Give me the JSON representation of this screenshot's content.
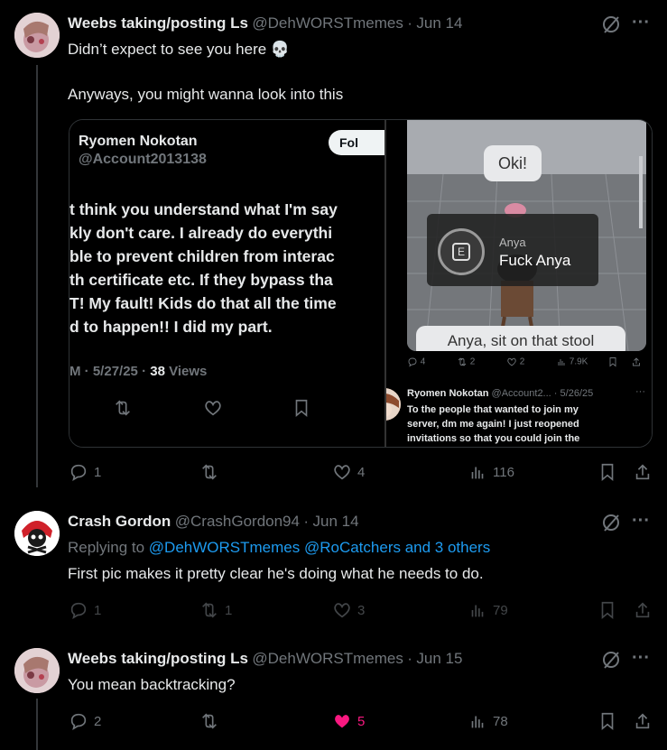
{
  "posts": [
    {
      "name": "Weebs taking/posting Ls",
      "handle": "@DehWORSTmemes",
      "sep": "·",
      "date": "Jun 14",
      "line1": "Didn’t expect to see you here 💀",
      "line2": "Anyways, you might wanna look into this",
      "replies": "1",
      "reposts": "",
      "likes": "4",
      "views": "116"
    },
    {
      "name": "Crash Gordon",
      "handle": "@CrashGordon94",
      "sep": "·",
      "date": "Jun 14",
      "replying_prefix": "Replying to",
      "replying_to": "@DehWORSTmemes @RoCatchers and 3 others",
      "text": "First pic makes it pretty clear he's doing what he needs to do.",
      "replies": "1",
      "reposts": "1",
      "likes": "3",
      "views": "79"
    },
    {
      "name": "Weebs taking/posting Ls",
      "handle": "@DehWORSTmemes",
      "sep": "·",
      "date": "Jun 15",
      "text": "You mean backtracking?",
      "replies": "2",
      "reposts": "",
      "likes": "5",
      "views": "78"
    }
  ],
  "embed_left": {
    "name": "Ryomen Nokotan",
    "handle": "@Account2013138",
    "follow_label": "Fol",
    "lines": [
      "t think you understand what I'm say",
      "kly don't care. I already do everythi",
      "ble to prevent children from interac",
      "th certificate etc. If they bypass tha",
      "T! My fault! Kids do that all the time",
      "d to happen!! I did my part."
    ],
    "meta_time": "M",
    "meta_sep": "·",
    "meta_date": "5/27/25",
    "meta_sep2": "·",
    "meta_views": "38",
    "meta_views_label": "Views"
  },
  "embed_right": {
    "bubble_oki": "Oki!",
    "popup_icon_letter": "E",
    "popup_small": "Anya",
    "popup_big": "Fuck Anya",
    "bottom_bubble": "Anya, sit on that stool",
    "stat_replies": "4",
    "stat_reposts": "2",
    "stat_likes": "2",
    "stat_views": "7.9K",
    "tweet_name": "Ryomen Nokotan",
    "tweet_handle": "@Account2...",
    "tweet_sep": "·",
    "tweet_date": "5/26/25",
    "tweet_more": "···",
    "tweet_line1": "To the people that wanted to join my",
    "tweet_line2": "server, dm me again! I just reopened",
    "tweet_line3": "invitations so that you could join the"
  },
  "more_label": "···",
  "colors": {
    "background": "#000000",
    "text": "#e7e9ea",
    "muted": "#71767b",
    "link": "#1d9bf0",
    "like_active": "#f91880",
    "border": "#2f3336"
  }
}
